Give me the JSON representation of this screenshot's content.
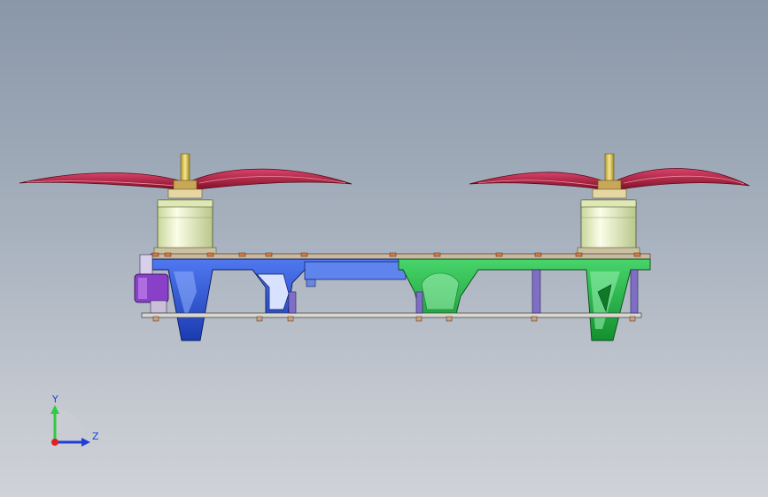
{
  "viewport": {
    "name": "cad-3d-viewport",
    "colors": {
      "background_top": "#8a97a8",
      "background_bottom": "#cfd2d7",
      "propeller": "#b0203c",
      "motor": "#eef5c4",
      "arm_blue": "#2d56d8",
      "arm_green": "#23b54a",
      "accent_purple": "#8a3fc9",
      "standoff": "#7f6fc4"
    }
  },
  "triad": {
    "y_label": "Y",
    "z_label": "Z",
    "y_color": "#2ecc40",
    "z_color": "#1f3fd6",
    "origin_color": "#e02020"
  }
}
